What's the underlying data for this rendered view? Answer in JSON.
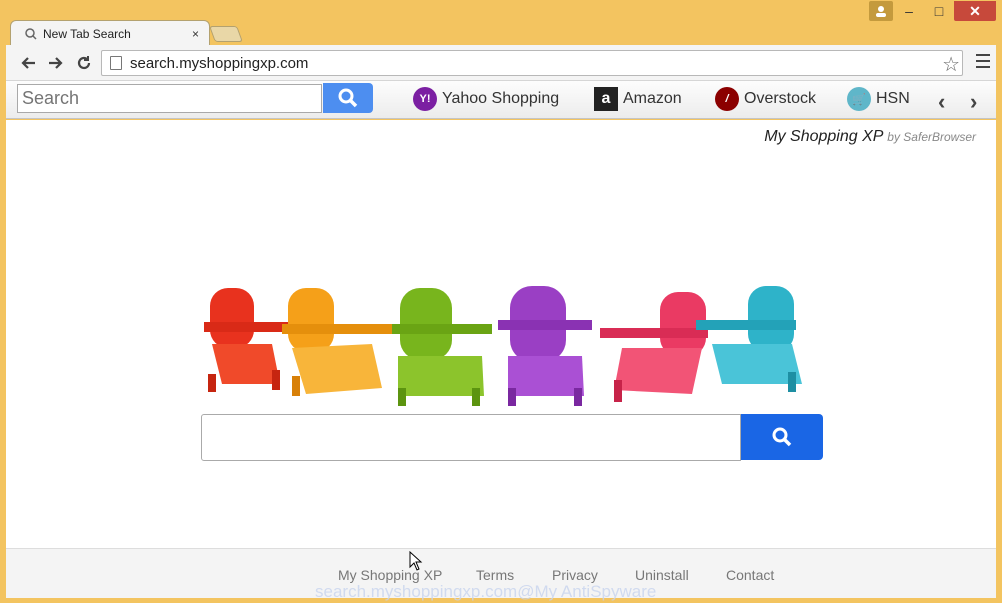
{
  "tab": {
    "title": "New Tab Search",
    "close": "×"
  },
  "window": {
    "minimize": "–",
    "maximize": "□",
    "close": "✕"
  },
  "omnibox": {
    "url": "search.myshoppingxp.com"
  },
  "ext_bar": {
    "search_placeholder": "Search",
    "links": [
      {
        "label": "Yahoo Shopping",
        "icon": "yahoo-icon",
        "color": "#7b1fa2"
      },
      {
        "label": "Amazon",
        "icon": "amazon-icon",
        "color": "#222222"
      },
      {
        "label": "Overstock",
        "icon": "overstock-icon",
        "color": "#8b0000"
      },
      {
        "label": "HSN",
        "icon": "hsn-icon",
        "color": "#5fb6c9"
      }
    ]
  },
  "brand": {
    "name": "My Shopping XP",
    "by": "by SaferBrowser"
  },
  "main_search": {
    "value": ""
  },
  "footer": {
    "links": [
      "My Shopping XP",
      "Terms",
      "Privacy",
      "Uninstall",
      "Contact"
    ]
  },
  "watermark": "search.myshoppingxp.com@My AntiSpyware",
  "colors": {
    "frame": "#f3c460",
    "search_btn": "#1a66e5",
    "ext_search_btn": "#4d8ef0"
  }
}
